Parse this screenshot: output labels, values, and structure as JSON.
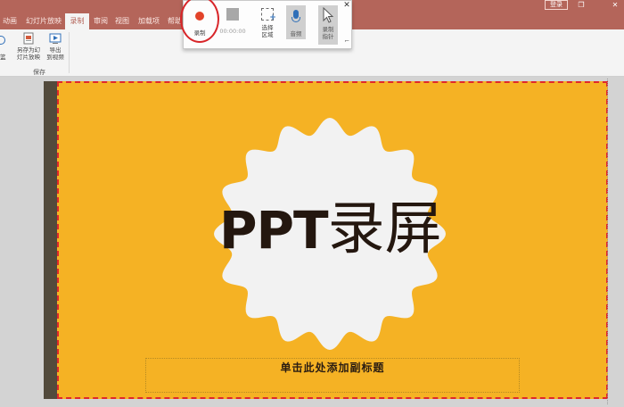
{
  "tabs": [
    {
      "label": "动画",
      "active": false
    },
    {
      "label": "幻灯片放映",
      "active": false
    },
    {
      "label": "录制",
      "active": true
    },
    {
      "label": "审阅",
      "active": false
    },
    {
      "label": "视图",
      "active": false
    },
    {
      "label": "加载项",
      "active": false
    },
    {
      "label": "帮助",
      "active": false
    }
  ],
  "account": {
    "signin_label": "登录"
  },
  "window": {
    "restore_glyph": "❐",
    "close_glyph": "✕"
  },
  "ribbon": {
    "partial_label": "篮",
    "save_as_show_label": "另存为幻\n灯片放映",
    "export_video_label": "导出\n到视频",
    "group_save_label": "保存"
  },
  "record_toolbar": {
    "record_label": "录制",
    "timer": "00:00:00",
    "select_area_label": "选择\n区域",
    "audio_label": "音频",
    "record_pointer_label": "录制\n指针",
    "close_glyph": "✕",
    "pin_glyph": "⌐"
  },
  "slide": {
    "title_latin": "PPT",
    "title_cjk": "录屏",
    "subtitle": "单击此处添加副标题"
  },
  "colors": {
    "tab_bar": "#b4655a",
    "slide_bg": "#f5b224",
    "badge": "#f2f2f2",
    "title_text": "#24170f",
    "selection_border": "#e0282a",
    "record_dot": "#e2432a"
  }
}
